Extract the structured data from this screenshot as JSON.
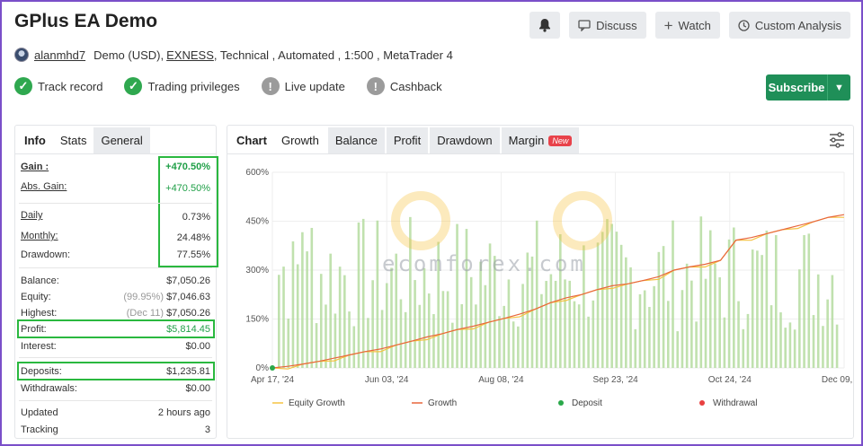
{
  "header": {
    "title": "GPlus EA Demo",
    "discuss_label": "Discuss",
    "watch_label": "Watch",
    "custom_analysis_label": "Custom Analysis"
  },
  "account": {
    "username": "alanmhd7",
    "type": "Demo (USD),",
    "broker": "EXNESS",
    "details": ", Technical , Automated , 1:500 , MetaTrader 4"
  },
  "badges": [
    {
      "label": "Track record",
      "status": "ok"
    },
    {
      "label": "Trading privileges",
      "status": "ok"
    },
    {
      "label": "Live update",
      "status": "warn"
    },
    {
      "label": "Cashback",
      "status": "warn"
    }
  ],
  "subscribe_label": "Subscribe",
  "left_tabs": [
    "Info",
    "Stats",
    "General"
  ],
  "stats": {
    "gain_label": "Gain :",
    "gain": "+470.50%",
    "abs_gain_label": "Abs. Gain:",
    "abs_gain": "+470.50%",
    "daily_label": "Daily",
    "daily": "0.73%",
    "monthly_label": "Monthly:",
    "monthly": "24.48%",
    "drawdown_label": "Drawdown:",
    "drawdown": "77.55%",
    "balance_label": "Balance:",
    "balance": "$7,050.26",
    "equity_label": "Equity:",
    "equity_note": "(99.95%)",
    "equity": "$7,046.63",
    "highest_label": "Highest:",
    "highest_note": "(Dec 11)",
    "highest": "$7,050.26",
    "profit_label": "Profit:",
    "profit": "$5,814.45",
    "interest_label": "Interest:",
    "interest": "$0.00",
    "deposits_label": "Deposits:",
    "deposits": "$1,235.81",
    "withdrawals_label": "Withdrawals:",
    "withdrawals": "$0.00",
    "updated_label": "Updated",
    "updated": "2 hours ago",
    "tracking_label": "Tracking",
    "tracking": "3"
  },
  "chart_tabs": [
    "Chart",
    "Growth",
    "Balance",
    "Profit",
    "Drawdown",
    "Margin"
  ],
  "new_badge": "New",
  "watermark": "ecomforex.com",
  "colors": {
    "equity": "#f5c242",
    "growth": "#e8663c",
    "bars": "#b5dca0",
    "deposit": "#2aa84a",
    "withdrawal": "#e84040",
    "accent": "#1f8f58"
  },
  "chart_data": {
    "type": "line",
    "y_ticks": [
      "600%",
      "450%",
      "300%",
      "150%",
      "0%"
    ],
    "ylim": [
      0,
      600
    ],
    "x_ticks": [
      "Apr 17, '24",
      "Jun 03, '24",
      "Aug 08, '24",
      "Sep 23, '24",
      "Oct 24, '24",
      "Dec 09, '24"
    ],
    "series": [
      {
        "name": "Equity Growth",
        "values": [
          0,
          5,
          12,
          20,
          30,
          40,
          50,
          58,
          70,
          82,
          95,
          105,
          118,
          128,
          140,
          152,
          165,
          180,
          200,
          215,
          225,
          240,
          252,
          258,
          268,
          280,
          300,
          310,
          318,
          330,
          392,
          400,
          412,
          424,
          436,
          448,
          462,
          470
        ]
      },
      {
        "name": "Growth",
        "values": [
          0,
          5,
          12,
          20,
          30,
          40,
          50,
          58,
          70,
          82,
          95,
          105,
          118,
          128,
          140,
          152,
          165,
          180,
          200,
          215,
          225,
          240,
          252,
          258,
          268,
          280,
          300,
          310,
          318,
          330,
          392,
          400,
          412,
          424,
          436,
          448,
          462,
          470
        ]
      },
      {
        "name": "Deposit",
        "values": [
          0
        ]
      },
      {
        "name": "Withdrawal",
        "values": []
      }
    ],
    "legend": [
      "Equity Growth",
      "Growth",
      "Deposit",
      "Withdrawal"
    ],
    "legend_position": "bottom",
    "grid": true
  }
}
